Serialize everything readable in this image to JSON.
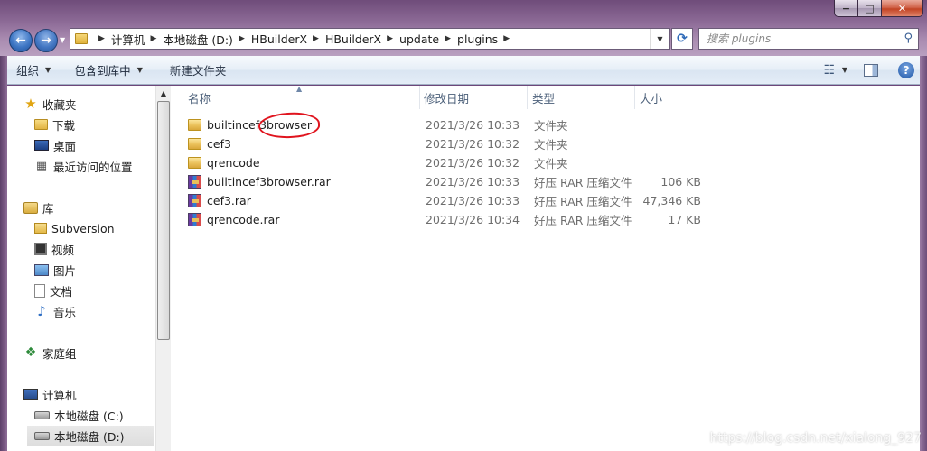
{
  "window": {
    "caption_buttons": {
      "minimize": "−",
      "maximize": "□",
      "close": "✕"
    }
  },
  "nav": {
    "back_glyph": "←",
    "forward_glyph": "→"
  },
  "address": {
    "crumbs": [
      "计算机",
      "本地磁盘 (D:)",
      "HBuilderX",
      "HBuilderX",
      "update",
      "plugins"
    ]
  },
  "search": {
    "placeholder": "搜索 plugins"
  },
  "toolbar": {
    "organize": "组织",
    "include_in_library": "包含到库中",
    "new_folder": "新建文件夹"
  },
  "sidebar": {
    "favorites": "收藏夹",
    "downloads": "下载",
    "desktop": "桌面",
    "recent": "最近访问的位置",
    "libraries": "库",
    "subversion": "Subversion",
    "videos": "视频",
    "pictures": "图片",
    "documents": "文档",
    "music": "音乐",
    "homegroup": "家庭组",
    "computer": "计算机",
    "drive_c": "本地磁盘 (C:)",
    "drive_d": "本地磁盘 (D:)"
  },
  "columns": {
    "name": "名称",
    "date": "修改日期",
    "type": "类型",
    "size": "大小"
  },
  "files": [
    {
      "name": "builtincef3browser",
      "date": "2021/3/26 10:33",
      "type": "文件夹",
      "size": "",
      "icon": "folder-icon"
    },
    {
      "name": "cef3",
      "date": "2021/3/26 10:32",
      "type": "文件夹",
      "size": "",
      "icon": "folder-icon"
    },
    {
      "name": "qrencode",
      "date": "2021/3/26 10:32",
      "type": "文件夹",
      "size": "",
      "icon": "folder-icon"
    },
    {
      "name": "builtincef3browser.rar",
      "date": "2021/3/26 10:33",
      "type": "好压 RAR 压缩文件",
      "size": "106 KB",
      "icon": "rar-archive-icon"
    },
    {
      "name": "cef3.rar",
      "date": "2021/3/26 10:33",
      "type": "好压 RAR 压缩文件",
      "size": "47,346 KB",
      "icon": "rar-archive-icon"
    },
    {
      "name": "qrencode.rar",
      "date": "2021/3/26 10:34",
      "type": "好压 RAR 压缩文件",
      "size": "17 KB",
      "icon": "rar-archive-icon"
    }
  ],
  "watermark": "https://blog.csdn.net/xialong_927",
  "colors": {
    "annotation_red": "#e0141e",
    "glass_purple": "#8d6b97"
  }
}
